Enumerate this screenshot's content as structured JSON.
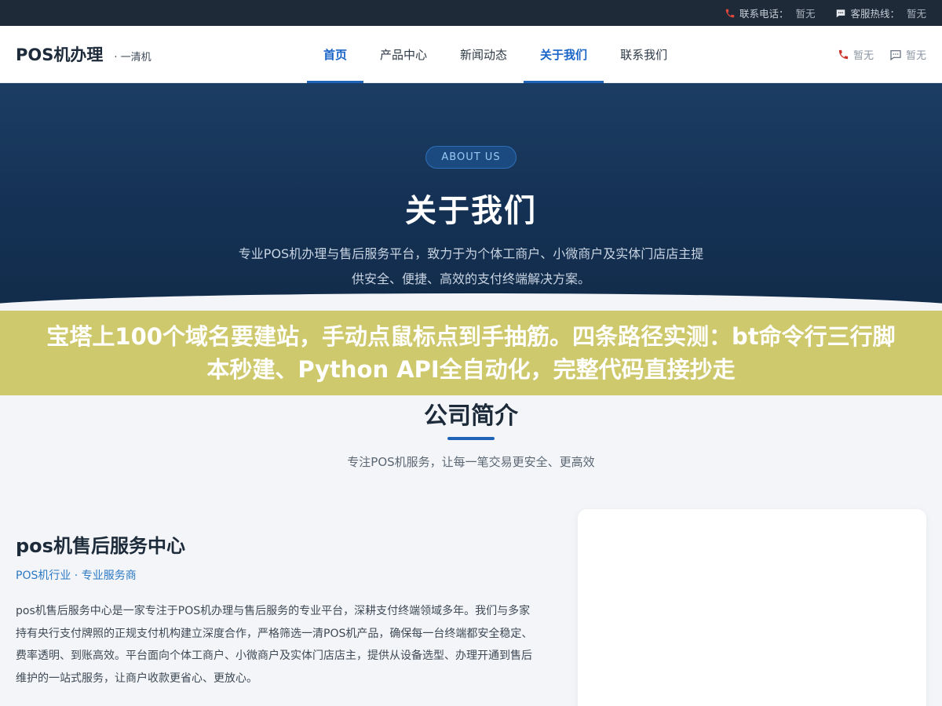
{
  "topbar": {
    "phone_label": "联系电话：",
    "phone_value": "暂无",
    "service_label": "客服热线：",
    "service_value": "暂无"
  },
  "header": {
    "brand": "POS机办理",
    "subtitle": "· 一清机",
    "nav": [
      {
        "label": "首页",
        "active": true
      },
      {
        "label": "产品中心",
        "active": false
      },
      {
        "label": "新闻动态",
        "active": false
      },
      {
        "label": "关于我们",
        "active": true
      },
      {
        "label": "联系我们",
        "active": false
      }
    ],
    "right_phone": "暂无",
    "right_chat": "暂无"
  },
  "hero": {
    "badge": "ABOUT US",
    "title": "关于我们",
    "description": "专业POS机办理与售后服务平台，致力于为个体工商户、小微商户及实体门店店主提供安全、便捷、高效的支付终端解决方案。"
  },
  "banner": {
    "text": "宝塔上100个域名要建站，手动点鼠标点到手抽筋。四条路径实测：bt命令行三行脚本秒建、Python API全自动化，完整代码直接抄走"
  },
  "section": {
    "title": "公司简介",
    "subtitle": "专注POS机服务，让每一笔交易更安全、更高效"
  },
  "company": {
    "name": "pos机售后服务中心",
    "tag": "POS机行业 · 专业服务商",
    "body": "pos机售后服务中心是一家专注于POS机办理与售后服务的专业平台，深耕支付终端领域多年。我们与多家持有央行支付牌照的正规支付机构建立深度合作，严格筛选一清POS机产品，确保每一台终端都安全稳定、费率透明、到账高效。平台面向个体工商户、小微商户及实体门店店主，提供从设备选型、办理开通到售后维护的一站式服务，让商户收款更省心、更放心。"
  },
  "colors": {
    "accent": "#1e63b8",
    "hero_bg": "#143154",
    "banner_bg": "#cfc96e",
    "topbar_bg": "#1e2a38"
  }
}
